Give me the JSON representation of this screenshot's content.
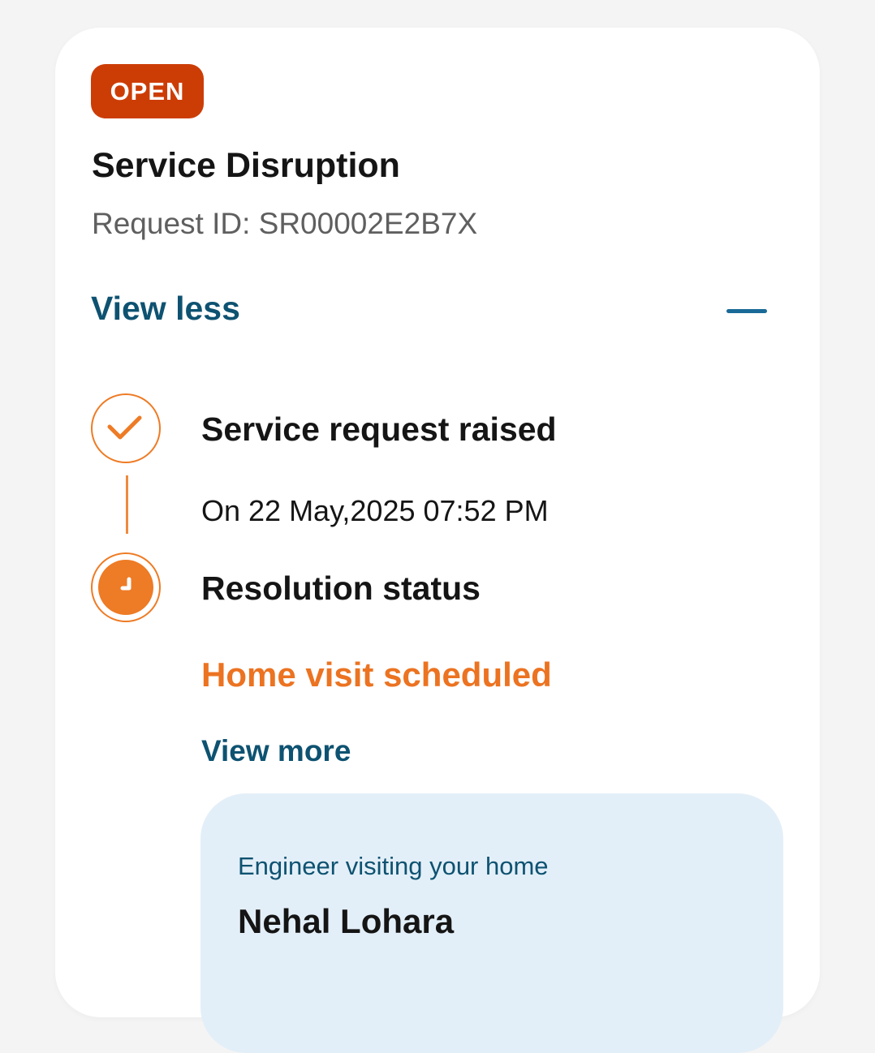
{
  "status_badge": "OPEN",
  "request": {
    "title": "Service Disruption",
    "id_text": "Request ID: SR00002E2B7X"
  },
  "toggle": {
    "label": "View less",
    "icon": "minus-icon"
  },
  "timeline": {
    "steps": [
      {
        "title": "Service request raised",
        "subtitle": "On 22 May,2025 07:52 PM",
        "icon": "check-icon"
      },
      {
        "title": "Resolution status",
        "status": "Home visit scheduled",
        "icon": "clock-icon",
        "link": "View more"
      }
    ]
  },
  "engineer": {
    "label": "Engineer visiting your home",
    "name": "Nehal Lohara"
  },
  "colors": {
    "badge": "#cc3d06",
    "accent_orange": "#ee7b25",
    "link_blue": "#0e5271",
    "panel_bg": "#e3eff8"
  }
}
